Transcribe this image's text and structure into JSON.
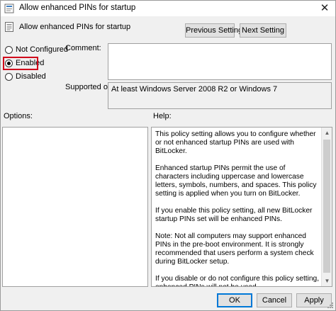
{
  "window": {
    "title": "Allow enhanced PINs for startup",
    "close_glyph": "✕"
  },
  "header": {
    "title": "Allow enhanced PINs for startup",
    "previous_label": "Previous Setting",
    "next_label": "Next Setting"
  },
  "state": {
    "options": [
      {
        "label": "Not Configured",
        "checked": false
      },
      {
        "label": "Enabled",
        "checked": true
      },
      {
        "label": "Disabled",
        "checked": false
      }
    ]
  },
  "comment": {
    "label": "Comment:",
    "value": ""
  },
  "supported": {
    "label": "Supported on:",
    "value": "At least Windows Server 2008 R2 or Windows 7"
  },
  "options_pane": {
    "label": "Options:"
  },
  "help_pane": {
    "label": "Help:",
    "paragraphs": [
      "This policy setting allows you to configure whether or not enhanced startup PINs are used with BitLocker.",
      "Enhanced startup PINs permit the use of characters including uppercase and lowercase letters, symbols, numbers, and spaces. This policy setting is applied when you turn on BitLocker.",
      "If you enable this policy setting, all new BitLocker startup PINs set will be enhanced PINs.",
      "Note:   Not all computers may support enhanced PINs in the pre-boot environment. It is strongly recommended that users perform a system check during BitLocker setup.",
      "If you disable or do not configure this policy setting, enhanced PINs will not be used."
    ]
  },
  "footer": {
    "ok_label": "OK",
    "cancel_label": "Cancel",
    "apply_label": "Apply"
  },
  "icons": {
    "title": "policy-settings-icon",
    "header": "policy-document-icon",
    "close": "close-icon",
    "scroll_up": "scroll-up-arrow-icon",
    "scroll_down": "scroll-down-arrow-icon",
    "resize": "resize-grip-icon"
  },
  "colors": {
    "highlight": "#d0021b",
    "default_button_border": "#0078d7",
    "window_background": "#f0f0f0"
  }
}
